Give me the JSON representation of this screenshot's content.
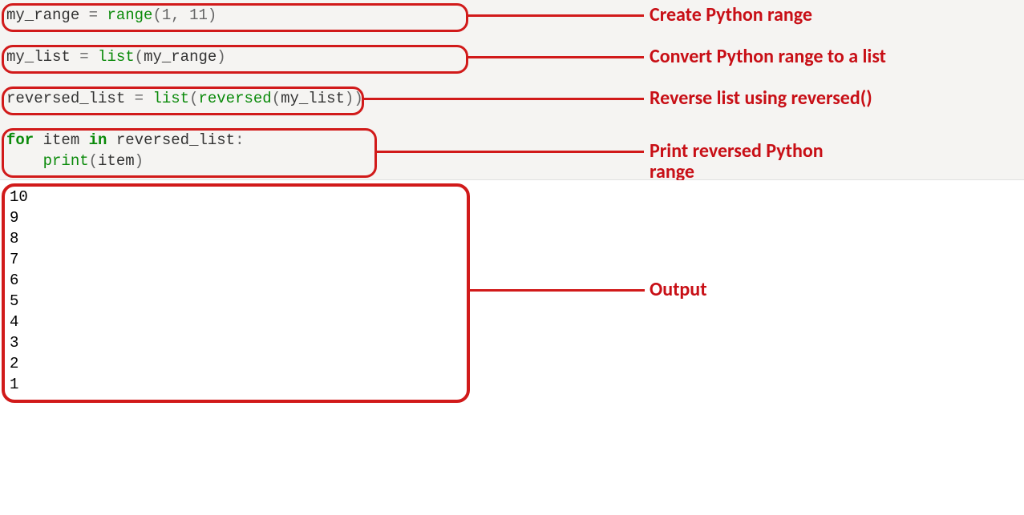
{
  "code": {
    "l1_id1": "my_range",
    "l1_op1": " = ",
    "l1_fn": "range",
    "l1_p1": "(",
    "l1_n1": "1",
    "l1_c": ", ",
    "l1_n2": "11",
    "l1_p2": ")",
    "l3_id1": "my_list",
    "l3_op1": " = ",
    "l3_fn": "list",
    "l3_p1": "(",
    "l3_id2": "my_range",
    "l3_p2": ")",
    "l5_id1": "reversed_list",
    "l5_op1": " = ",
    "l5_fn1": "list",
    "l5_p1": "(",
    "l5_fn2": "reversed",
    "l5_p2": "(",
    "l5_id2": "my_list",
    "l5_p3": ")",
    "l5_p4": ")",
    "l7_kw1": "for",
    "l7_sp1": " ",
    "l7_id1": "item",
    "l7_sp2": " ",
    "l7_kw2": "in",
    "l7_sp3": " ",
    "l7_id2": "reversed_list",
    "l7_col": ":",
    "l8_ind": "    ",
    "l8_fn": "print",
    "l8_p1": "(",
    "l8_id": "item",
    "l8_p2": ")"
  },
  "annotations": {
    "a1": "Create Python range",
    "a2": "Convert Python range to a list",
    "a3": "Reverse list using reversed()",
    "a4": "Print reversed Python range",
    "a5": "Output"
  },
  "output": {
    "l0": "10",
    "l1": "9",
    "l2": "8",
    "l3": "7",
    "l4": "6",
    "l5": "5",
    "l6": "4",
    "l7": "3",
    "l8": "2",
    "l9": "1"
  }
}
